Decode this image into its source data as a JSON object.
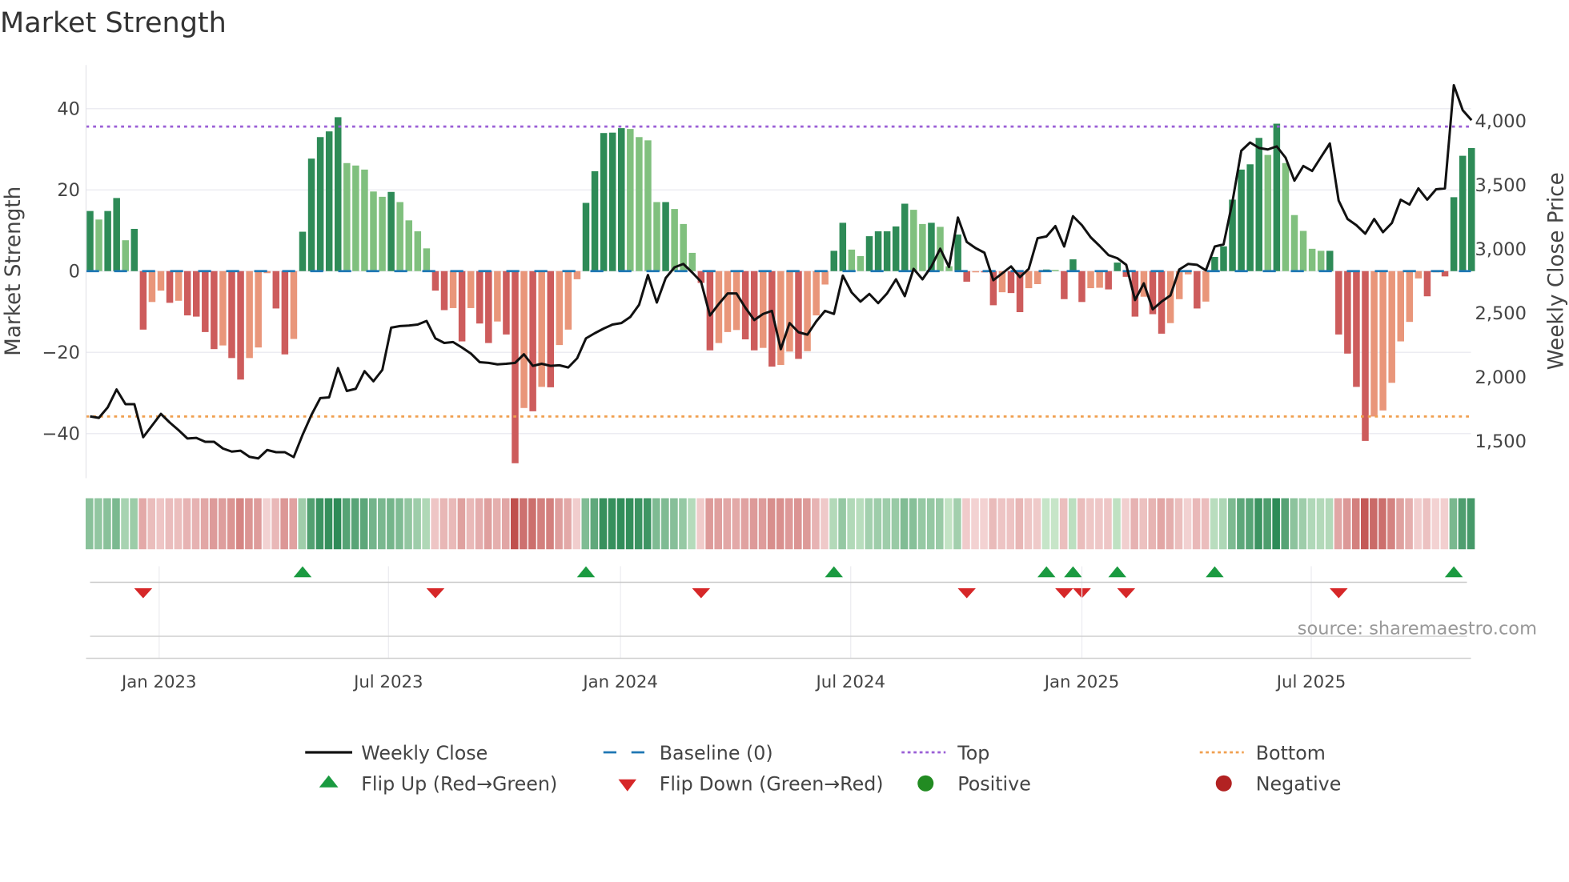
{
  "chart_data": {
    "type": "bar",
    "title": "Market Strength",
    "ylabel": "Market Strength",
    "y2label": "Weekly Close Price",
    "ylim": [
      -51,
      55
    ],
    "y2lim": [
      1200,
      4600
    ],
    "yticks": [
      40,
      20,
      0,
      -20,
      -40
    ],
    "ytick_labels": [
      "40",
      "20",
      "0",
      "−20",
      "−40"
    ],
    "y2ticks": [
      4000,
      3500,
      3000,
      2500,
      2000,
      1500
    ],
    "y2tick_labels": [
      "4,000",
      "3,500",
      "3,000",
      "2,500",
      "2,000",
      "1,500"
    ],
    "x_unit": "week index",
    "xticks": [
      7.8,
      33.7,
      59.9,
      85.9,
      112.0,
      137.9
    ],
    "xtick_labels": [
      "Jan 2023",
      "Jul 2023",
      "Jan 2024",
      "Jul 2024",
      "Jan 2025",
      "Jul 2025"
    ],
    "top_level": 35.6,
    "bottom_level": -35.8,
    "baseline": 0,
    "strength": [
      14.8,
      12.7,
      14.8,
      18,
      7.6,
      10.4,
      -14.4,
      -7.6,
      -4.8,
      -7.8,
      -7.3,
      -10.9,
      -11.2,
      -15,
      -19.2,
      -18.3,
      -21.4,
      -26.7,
      -21.4,
      -18.8,
      -0.5,
      -9.2,
      -20.5,
      -16.7,
      9.7,
      27.7,
      33,
      34.4,
      37.9,
      26.6,
      26,
      25,
      19.6,
      18.3,
      19.5,
      17,
      12.5,
      9.8,
      5.6,
      -4.8,
      -9.6,
      -9.1,
      -17.3,
      -9.1,
      -12.9,
      -17.7,
      -12.4,
      -15.6,
      -47.3,
      -33.7,
      -34.5,
      -28.5,
      -28.6,
      -18.2,
      -14.4,
      -2,
      16.8,
      24.6,
      34,
      34.1,
      35.2,
      35,
      33,
      32.2,
      17,
      17,
      15.3,
      11.6,
      4.5,
      -2.9,
      -19.5,
      -17.7,
      -15,
      -14.5,
      -16.8,
      -19.5,
      -18.9,
      -23.5,
      -23.1,
      -19.8,
      -21.6,
      -19.7,
      -10.9,
      -3.3,
      5,
      11.9,
      5.3,
      3.7,
      8.6,
      9.8,
      9.8,
      11,
      16.6,
      15.1,
      11.6,
      11.9,
      10.9,
      1.2,
      9,
      -2.6,
      -0.3,
      -0.3,
      -8.4,
      -5.2,
      -5.4,
      -10.1,
      -4.2,
      -3.2,
      0.4,
      0.3,
      -6.9,
      2.9,
      -7.6,
      -4.2,
      -4.1,
      -4.5,
      2.1,
      -1.4,
      -11.2,
      -6.3,
      -10.6,
      -15.4,
      -12.8,
      -6.9,
      -0.8,
      -9.2,
      -7.5,
      3.5,
      6.1,
      17.6,
      25,
      26.3,
      32.8,
      28.6,
      36.3,
      26.6,
      13.8,
      9.9,
      5.5,
      5,
      5,
      -15.6,
      -20.3,
      -28.5,
      -41.8,
      -35.8,
      -34.3,
      -27.5,
      -17.3,
      -12.5,
      -1.8,
      -6.2,
      -0.3,
      -1.3,
      18.2,
      28.4,
      30.3
    ],
    "weekly_close": [
      1694,
      1682,
      1765,
      1904,
      1789,
      1789,
      1531,
      1622,
      1713,
      1646,
      1586,
      1521,
      1526,
      1495,
      1495,
      1443,
      1419,
      1426,
      1378,
      1366,
      1431,
      1414,
      1414,
      1376,
      1550,
      1706,
      1837,
      1842,
      2071,
      1892,
      1909,
      2047,
      1968,
      2057,
      2387,
      2399,
      2403,
      2411,
      2439,
      2303,
      2267,
      2274,
      2231,
      2184,
      2117,
      2112,
      2100,
      2105,
      2112,
      2179,
      2088,
      2105,
      2088,
      2093,
      2076,
      2148,
      2303,
      2344,
      2380,
      2411,
      2423,
      2470,
      2566,
      2798,
      2583,
      2774,
      2858,
      2884,
      2817,
      2745,
      2482,
      2573,
      2654,
      2654,
      2542,
      2446,
      2494,
      2518,
      2219,
      2423,
      2351,
      2332,
      2435,
      2518,
      2494,
      2793,
      2662,
      2590,
      2650,
      2578,
      2654,
      2764,
      2633,
      2846,
      2764,
      2865,
      3003,
      2860,
      3247,
      3056,
      3008,
      2972,
      2757,
      2810,
      2865,
      2781,
      2846,
      3085,
      3099,
      3180,
      3020,
      3257,
      3187,
      3092,
      3025,
      2953,
      2929,
      2877,
      2602,
      2733,
      2530,
      2590,
      2638,
      2841,
      2884,
      2877,
      2834,
      3020,
      3037,
      3367,
      3768,
      3833,
      3790,
      3778,
      3802,
      3713,
      3534,
      3649,
      3610,
      3718,
      3825,
      3379,
      3235,
      3187,
      3120,
      3235,
      3132,
      3204,
      3386,
      3348,
      3474,
      3386,
      3467,
      3474,
      4280,
      4084,
      4007
    ],
    "flip_up_weeks": [
      24,
      56,
      84,
      108,
      111,
      116,
      127,
      154
    ],
    "flip_down_weeks": [
      6,
      39,
      69,
      99,
      110,
      112,
      117,
      141
    ],
    "legend": [
      {
        "label": "Weekly Close",
        "kind": "line"
      },
      {
        "label": "Baseline (0)",
        "kind": "dash"
      },
      {
        "label": "Top",
        "kind": "dotted-top"
      },
      {
        "label": "Bottom",
        "kind": "dotted-bottom"
      },
      {
        "label": "Flip Up (Red→Green)",
        "kind": "triangle-up"
      },
      {
        "label": "Flip Down (Green→Red)",
        "kind": "triangle-down"
      },
      {
        "label": "Positive",
        "kind": "dot-green"
      },
      {
        "label": "Negative",
        "kind": "dot-red"
      }
    ],
    "legend_placement": "bottom",
    "source": "source: sharemaestro.com",
    "colors": {
      "pos_strong": "#2e8b57",
      "pos_weak": "#80c07e",
      "neg_strong": "#cd5c5c",
      "neg_weak": "#e9967a",
      "line": "#111111",
      "baseline": "#1f77b4",
      "top": "#9b5fd6",
      "bottom": "#f0a050",
      "flip_up": "#1a9a40",
      "flip_down": "#d62728",
      "dot_pos": "#228b22",
      "dot_neg": "#b22222"
    }
  }
}
